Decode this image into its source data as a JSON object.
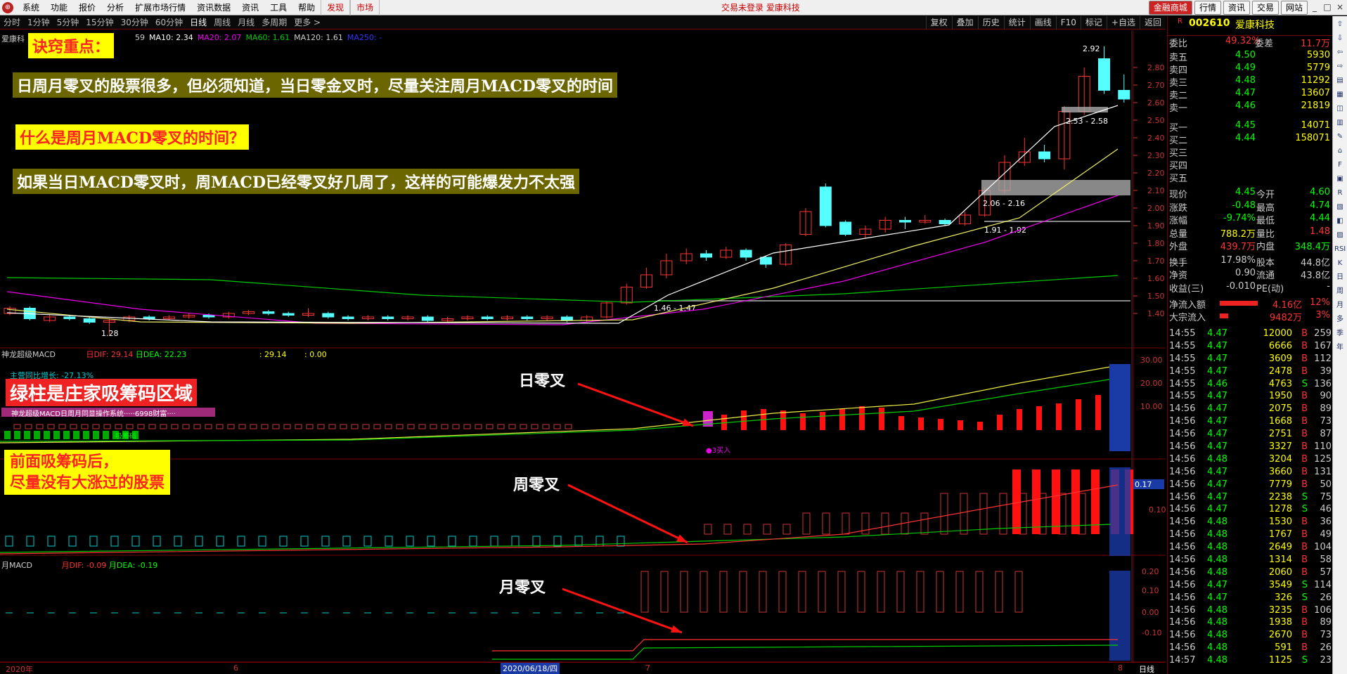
{
  "menubar": {
    "logo": "",
    "items": [
      "系统",
      "功能",
      "报价",
      "分析",
      "扩展市场行情",
      "资讯数据",
      "资讯",
      "工具",
      "帮助"
    ],
    "hot_items": [
      "发现",
      "市场"
    ],
    "status": "交易未登录  爱康科技",
    "right_buttons": [
      "金融商城",
      "行情",
      "资讯",
      "交易",
      "网站"
    ],
    "window_controls": [
      "_",
      "□",
      "×"
    ]
  },
  "period_tabs": [
    "分时",
    "1分钟",
    "5分钟",
    "15分钟",
    "30分钟",
    "60分钟",
    "日线",
    "周线",
    "月线",
    "多周期",
    "更多 >"
  ],
  "selected_period": "日线",
  "toolbar": [
    "复权",
    "叠加",
    "历史",
    "统计",
    "画线",
    "F10",
    "标记",
    "+自选",
    "返回"
  ],
  "chart_header": {
    "stock": "爱康科",
    "ma": [
      {
        "t": "59",
        "c": "#ccc"
      },
      {
        "t": "MA10: 2.34",
        "c": "#fff"
      },
      {
        "t": "MA20: 2.07",
        "c": "#e0e"
      },
      {
        "t": "MA60: 1.61",
        "c": "#0c0"
      },
      {
        "t": "MA120: 1.61",
        "c": "#ccc"
      },
      {
        "t": "MA250: -",
        "c": "#33f"
      }
    ]
  },
  "notes": {
    "title": "诀窍重点：",
    "n1": "日周月零叉的股票很多，但必须知道，当日零金叉时，尽量关注周月MACD零叉的时间",
    "n2": "什么是周月MACD零叉的时间？",
    "n3": "如果当日MACD零叉时，周MACD已经零叉好几周了，这样的可能爆发力不太强",
    "green": "绿柱是庄家吸筹码区域",
    "after": "前面吸筹码后，\n尽量没有大涨过的股票",
    "day_cross": "日零叉",
    "week_cross": "周零叉",
    "month_cross": "月零叉"
  },
  "price_axis": [
    "2.80",
    "2.70",
    "2.60",
    "2.50",
    "2.40",
    "2.30",
    "2.20",
    "2.10",
    "2.00",
    "1.90",
    "1.80",
    "1.70",
    "1.60",
    "1.50",
    "1.40"
  ],
  "price_labels": {
    "high": "2.92",
    "r1": "2.53 - 2.58",
    "r2": "2.06 - 2.16",
    "r3": "1.91 - 1.92",
    "r4": "1.46 - 1.47",
    "low": "1.28"
  },
  "macd_header": {
    "name": "神龙超级MACD",
    "dif": "日DIF: 29.14",
    "dea": "日DEA: 22.23",
    "v1": ": 29.14",
    "v2": ": 0.00",
    "sub": "主营同比增长: -27.13%",
    "promo": "神龙超级MACD日周月同显操作系统·····6998财富····",
    "xcm": "吸筹码",
    "buy3": "●3买入"
  },
  "macd_axis": [
    "30.00",
    "20.00",
    "10.00"
  ],
  "week_axis": {
    "v": "0.17",
    "t": "0.10"
  },
  "month_header": {
    "name": "月MACD",
    "dif": "月DIF: -0.09",
    "dea": "月DEA: -0.19"
  },
  "month_axis": [
    "0.20",
    "0.10",
    "0.00",
    "-0.10"
  ],
  "date_axis": {
    "d1": "2020年",
    "d2": "6",
    "d3": "2020/06/18/四",
    "d4": "7",
    "d5": "8",
    "period": "日线"
  },
  "quote": {
    "code": "002610",
    "name": "爱康科技",
    "r": "R",
    "wb": {
      "l": "委比",
      "v": "49.32%",
      "l2": "委差",
      "v2": "11.7万"
    },
    "sell": [
      {
        "l": "卖五",
        "p": "4.50",
        "v": "5930"
      },
      {
        "l": "卖四",
        "p": "4.49",
        "v": "5779"
      },
      {
        "l": "卖三",
        "p": "4.48",
        "v": "11292"
      },
      {
        "l": "卖二",
        "p": "4.47",
        "v": "13607"
      },
      {
        "l": "卖一",
        "p": "4.46",
        "v": "21819"
      }
    ],
    "buy": [
      {
        "l": "买一",
        "p": "4.45",
        "v": "14071"
      },
      {
        "l": "买二",
        "p": "4.44",
        "v": "158071"
      },
      {
        "l": "买三",
        "p": "",
        "v": ""
      },
      {
        "l": "买四",
        "p": "",
        "v": ""
      },
      {
        "l": "买五",
        "p": "",
        "v": ""
      }
    ],
    "stats": [
      {
        "a": "现价",
        "b": "4.45",
        "c": "今开",
        "d": "4.60",
        "bc": "#0f0",
        "dc": "#0f0"
      },
      {
        "a": "涨跌",
        "b": "-0.48",
        "c": "最高",
        "d": "4.74",
        "bc": "#0f0",
        "dc": "#0f0"
      },
      {
        "a": "涨幅",
        "b": "-9.74%",
        "c": "最低",
        "d": "4.44",
        "bc": "#0f0",
        "dc": "#0f0"
      },
      {
        "a": "总量",
        "b": "788.2万",
        "c": "量比",
        "d": "1.48",
        "bc": "#ff0",
        "dc": "#f33"
      },
      {
        "a": "外盘",
        "b": "439.7万",
        "c": "内盘",
        "d": "348.4万",
        "bc": "#f33",
        "dc": "#0f0"
      },
      {
        "a": "换手",
        "b": "17.98%",
        "c": "股本",
        "d": "44.8亿",
        "bc": "#ccc",
        "dc": "#ccc"
      },
      {
        "a": "净资",
        "b": "0.90",
        "c": "流通",
        "d": "43.8亿",
        "bc": "#ccc",
        "dc": "#ccc"
      },
      {
        "a": "收益(三)",
        "b": "-0.010",
        "c": "PE(动)",
        "d": "-",
        "bc": "#ccc",
        "dc": "#ccc"
      }
    ],
    "flow": [
      {
        "l": "净流入额",
        "v": "4.16亿",
        "p": "12%"
      },
      {
        "l": "大宗流入",
        "v": "9482万",
        "p": "3%"
      }
    ]
  },
  "tape": [
    [
      "14:55",
      "4.47",
      "12000",
      "B",
      "259"
    ],
    [
      "14:55",
      "4.47",
      "6666",
      "B",
      "167"
    ],
    [
      "14:55",
      "4.47",
      "3609",
      "B",
      "112"
    ],
    [
      "14:55",
      "4.47",
      "2478",
      "B",
      "39"
    ],
    [
      "14:55",
      "4.46",
      "4763",
      "S",
      "136"
    ],
    [
      "14:55",
      "4.47",
      "1950",
      "B",
      "90"
    ],
    [
      "14:56",
      "4.47",
      "2075",
      "B",
      "89"
    ],
    [
      "14:56",
      "4.47",
      "1668",
      "B",
      "73"
    ],
    [
      "14:56",
      "4.47",
      "2751",
      "B",
      "87"
    ],
    [
      "14:56",
      "4.47",
      "3327",
      "B",
      "110"
    ],
    [
      "14:56",
      "4.48",
      "3204",
      "B",
      "125"
    ],
    [
      "14:56",
      "4.47",
      "3660",
      "B",
      "131"
    ],
    [
      "14:56",
      "4.47",
      "7779",
      "B",
      "50"
    ],
    [
      "14:56",
      "4.47",
      "2238",
      "S",
      "75"
    ],
    [
      "14:56",
      "4.47",
      "1278",
      "S",
      "46"
    ],
    [
      "14:56",
      "4.48",
      "1530",
      "B",
      "36"
    ],
    [
      "14:56",
      "4.48",
      "1767",
      "B",
      "49"
    ],
    [
      "14:56",
      "4.48",
      "2649",
      "B",
      "104"
    ],
    [
      "14:56",
      "4.48",
      "1314",
      "B",
      "58"
    ],
    [
      "14:56",
      "4.48",
      "2060",
      "B",
      "57"
    ],
    [
      "14:56",
      "4.47",
      "3549",
      "S",
      "114"
    ],
    [
      "14:56",
      "4.47",
      "326",
      "S",
      "26"
    ],
    [
      "14:56",
      "4.48",
      "3235",
      "B",
      "106"
    ],
    [
      "14:56",
      "4.48",
      "1938",
      "B",
      "89"
    ],
    [
      "14:56",
      "4.48",
      "2670",
      "B",
      "73"
    ],
    [
      "14:56",
      "4.48",
      "591",
      "B",
      "26"
    ],
    [
      "14:57",
      "4.48",
      "1125",
      "S",
      "23"
    ]
  ],
  "side_icons": [
    "⇧",
    "⇩",
    "⇦",
    "⇨",
    "▤",
    "▦",
    "◫",
    "▥",
    "✎",
    "⌂",
    "F",
    "▣",
    "R",
    "▧",
    "◧",
    "▨",
    "RSI",
    "K",
    "日",
    "周",
    "月",
    "多",
    "季",
    "年"
  ]
}
